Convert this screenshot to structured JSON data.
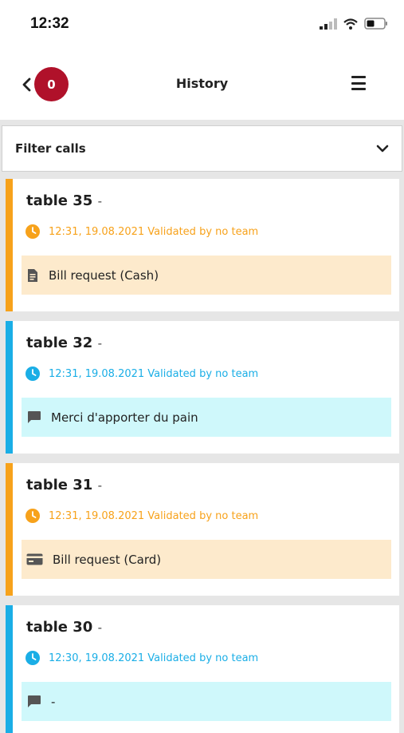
{
  "status_bar": {
    "time": "12:32"
  },
  "header": {
    "badge_count": "0",
    "title": "History"
  },
  "filter": {
    "label": "Filter calls"
  },
  "colors": {
    "orange": "#f7a21b",
    "blue": "#1aaee6",
    "orange_bg": "#fdeacc",
    "blue_bg": "#cff8fb",
    "badge": "#b0112a"
  },
  "calls": [
    {
      "table": "table 35",
      "dash": "-",
      "meta": "12:31, 19.08.2021 Validated by no team",
      "note": "Bill request (Cash)",
      "color": "orange",
      "icon": "receipt-icon"
    },
    {
      "table": "table 32",
      "dash": "-",
      "meta": "12:31, 19.08.2021 Validated by no team",
      "note": "Merci d'apporter du pain",
      "color": "blue",
      "icon": "chat-bubble-icon"
    },
    {
      "table": "table 31",
      "dash": "-",
      "meta": "12:31, 19.08.2021 Validated by no team",
      "note": "Bill request (Card)",
      "color": "orange",
      "icon": "credit-card-icon"
    },
    {
      "table": "table 30",
      "dash": "-",
      "meta": "12:30, 19.08.2021 Validated by no team",
      "note": "-",
      "color": "blue",
      "icon": "chat-bubble-icon"
    }
  ]
}
